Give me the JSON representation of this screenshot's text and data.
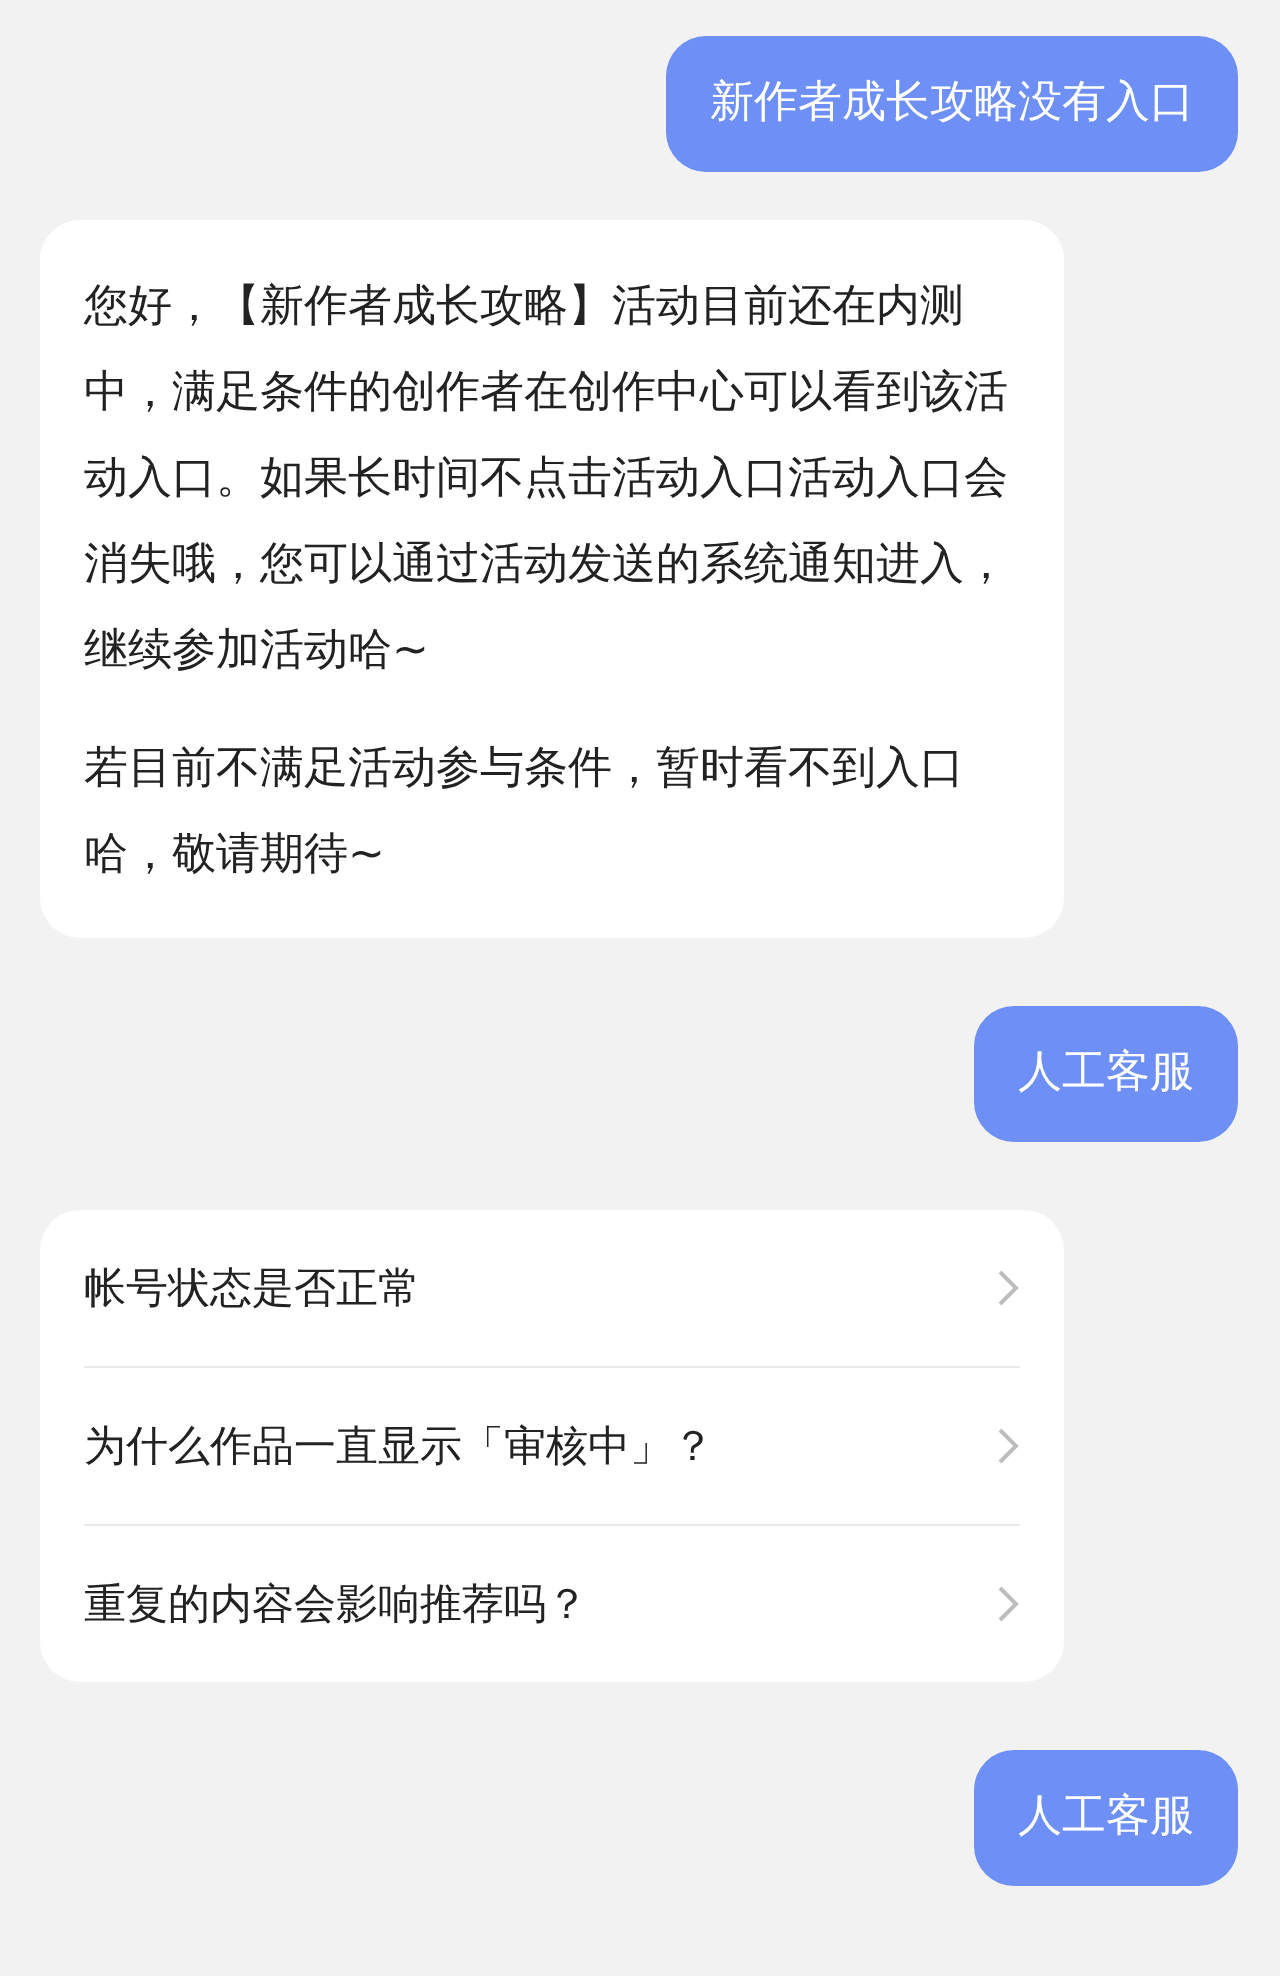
{
  "messages": [
    {
      "kind": "user",
      "text": "新作者成长攻略没有入口"
    },
    {
      "kind": "bot",
      "paragraphs": [
        "您好，【新作者成长攻略】活动目前还在内测中，满足条件的创作者在创作中心可以看到该活动入口。如果长时间不点击活动入口活动入口会消失哦，您可以通过活动发送的系统通知进入，继续参加活动哈~",
        "若目前不满足活动参与条件，暂时看不到入口哈，敬请期待~"
      ]
    },
    {
      "kind": "user",
      "text": "人工客服"
    },
    {
      "kind": "questions",
      "items": [
        "帐号状态是否正常",
        "为什么作品一直显示「审核中」？",
        "重复的内容会影响推荐吗？"
      ]
    },
    {
      "kind": "user",
      "text": "人工客服"
    }
  ]
}
